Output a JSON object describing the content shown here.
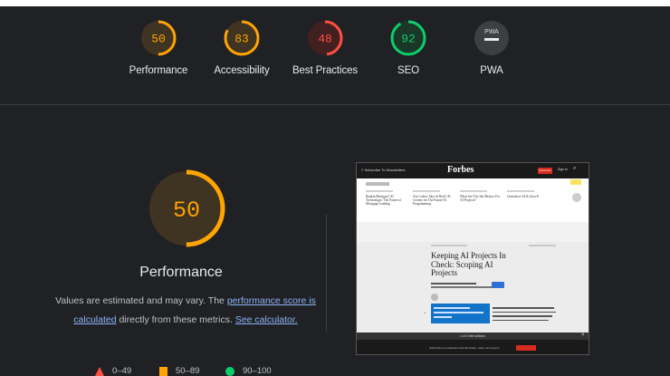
{
  "categories": [
    {
      "score": "50",
      "label": "Performance",
      "value": 0.5,
      "color": "#ffa400",
      "bg": "#3f3322"
    },
    {
      "score": "83",
      "label": "Accessibility",
      "value": 0.83,
      "color": "#ffa400",
      "bg": "#3f3322"
    },
    {
      "score": "48",
      "label": "Best Practices",
      "value": 0.48,
      "color": "#ff4e42",
      "bg": "#41201f"
    },
    {
      "score": "92",
      "label": "SEO",
      "value": 0.92,
      "color": "#0cce6b",
      "bg": "#1a3727"
    },
    {
      "score": "PWA",
      "label": "PWA",
      "color": "#9aa0a6",
      "bg": "#3c4043"
    }
  ],
  "main": {
    "score": "50",
    "value": 0.5,
    "color": "#ffa400",
    "title": "Performance",
    "note_pre": "Values are estimated and may vary. The ",
    "note_link1": "performance score is calculated",
    "note_mid": " directly from these metrics. ",
    "note_link2": "See calculator."
  },
  "legend": {
    "fail": "0–49",
    "average": "50–89",
    "pass": "90–100"
  },
  "screenshot": {
    "logo": "Forbes",
    "headline": "Keeping AI Projects In Check: Scoping AI Projects",
    "nav_left": "Subscribe To Newsletters",
    "subscribe": "Subscribe",
    "signin": "Sign In",
    "cookie_bar": "1 of 4 free articles",
    "bottom_bar": "Subscribe to newsletters that illuminate, inform and inspire",
    "trending": [
      "Rankin Matrigan? AI Technologie: The Future of Mortgage Lending",
      "Are Coders Jobs At Risk? AI Creates for The Future Of Programming",
      "What Are The Job Metrics For AI Projects?",
      "Generative AI & Zero-E"
    ]
  },
  "colors": {
    "accent_link": "#8ab4f8",
    "fail": "#ff4e42",
    "average": "#ffa400",
    "pass": "#0cce6b"
  }
}
